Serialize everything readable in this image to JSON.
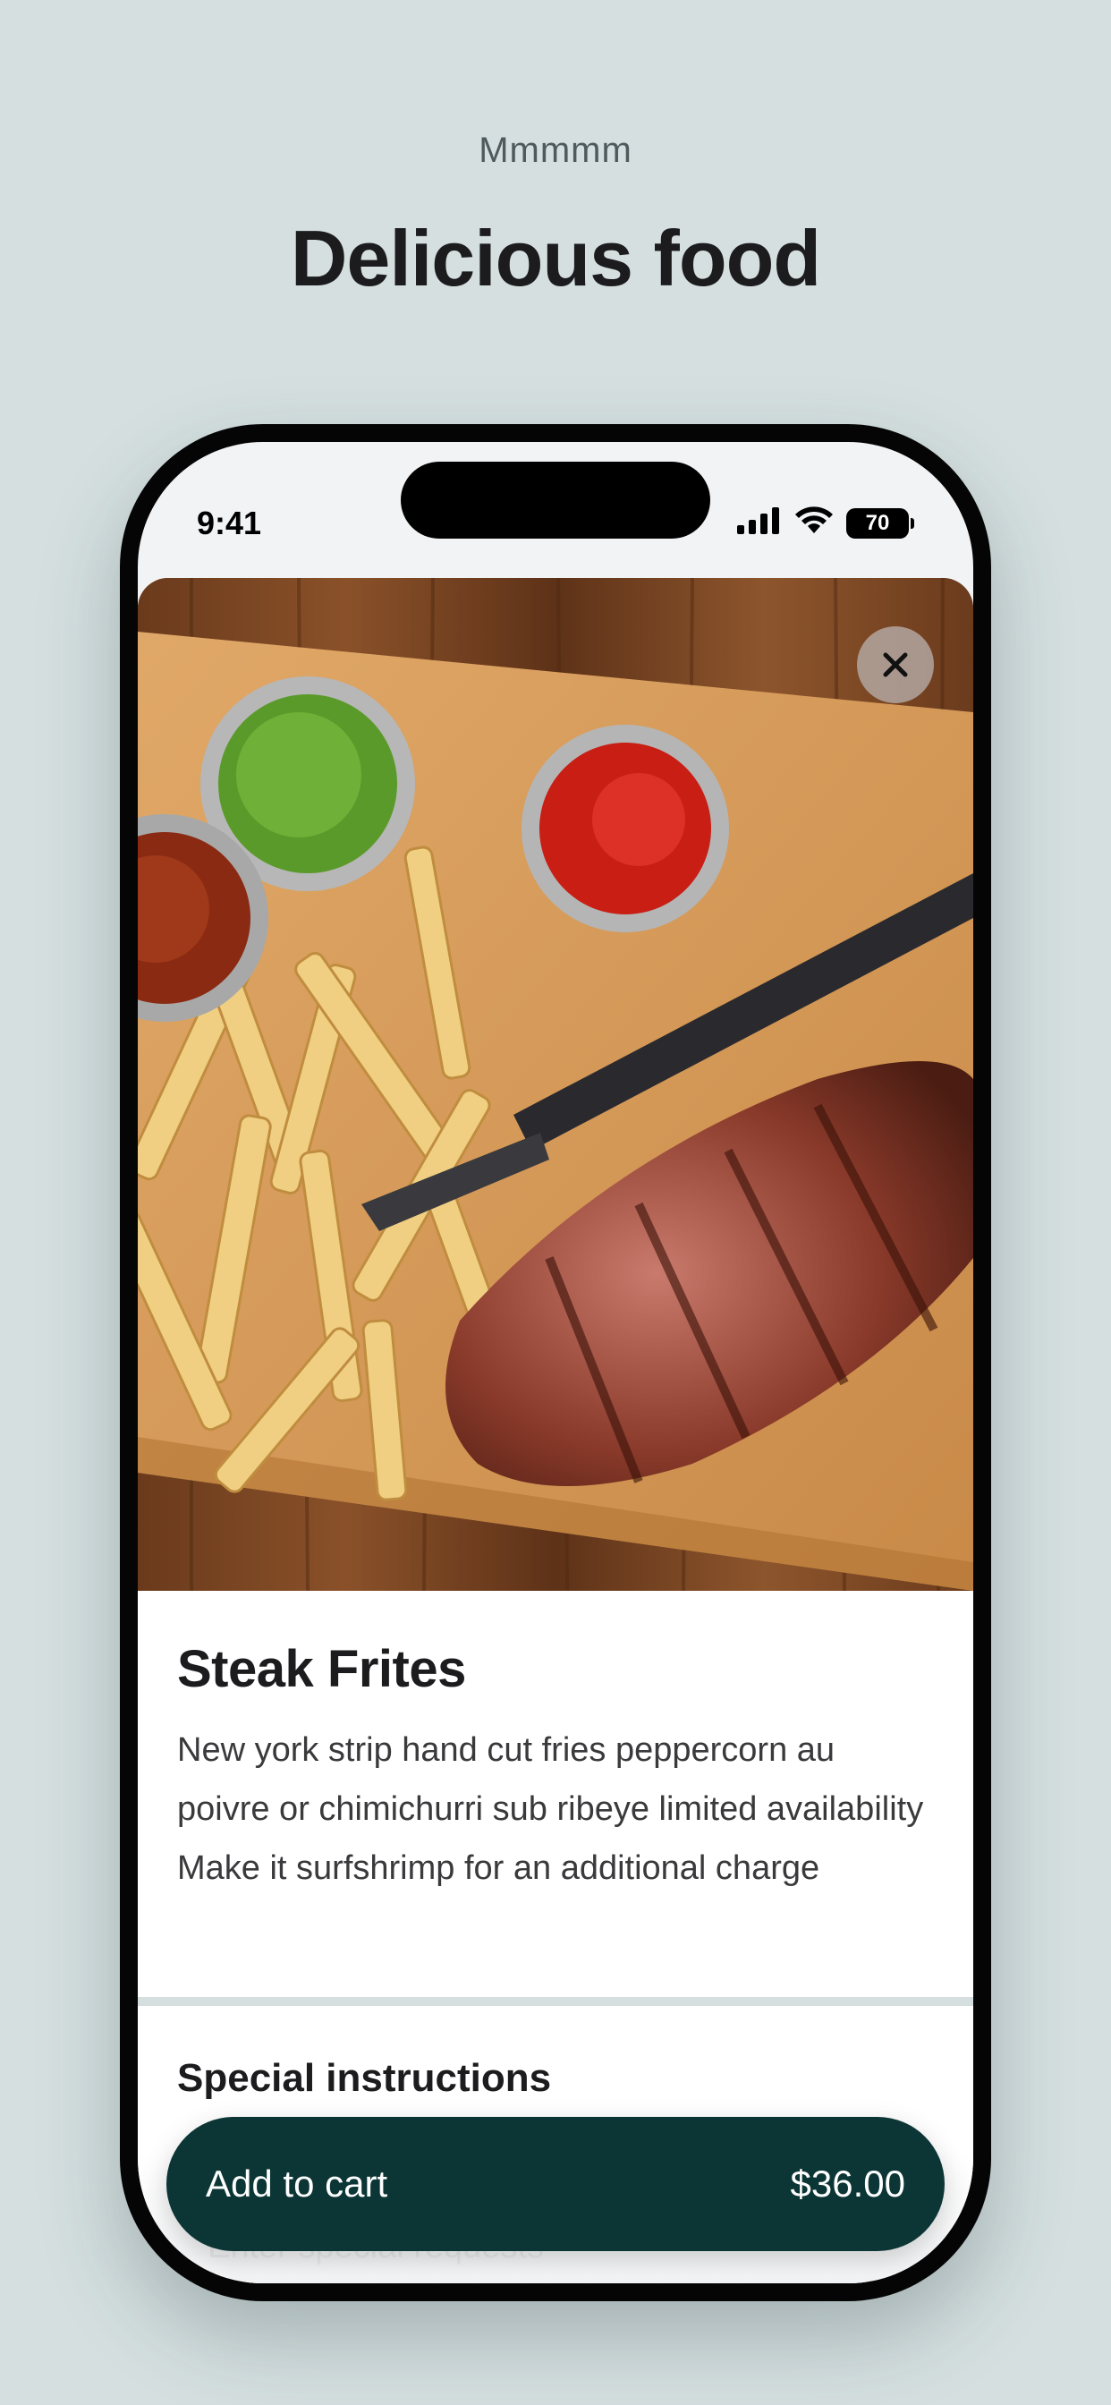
{
  "page": {
    "eyebrow": "Mmmmm",
    "headline": "Delicious food"
  },
  "status_bar": {
    "time": "9:41",
    "battery": "70",
    "icons": [
      "signal-icon",
      "wifi-icon",
      "battery-icon"
    ]
  },
  "item": {
    "image_alt": "steak-frites-photo",
    "title": "Steak Frites",
    "description": "New york strip hand cut fries peppercorn au poivre or chimichurri sub ribeye limited availability Make it surfshrimp for an additional charge"
  },
  "special_instructions": {
    "title": "Special instructions",
    "placeholder": "Enter special requests",
    "value": ""
  },
  "cart": {
    "label": "Add to cart",
    "price": "$36.00"
  },
  "colors": {
    "background": "#d5dfe0",
    "accent": "#0c3635",
    "text": "#1c1c1e"
  }
}
